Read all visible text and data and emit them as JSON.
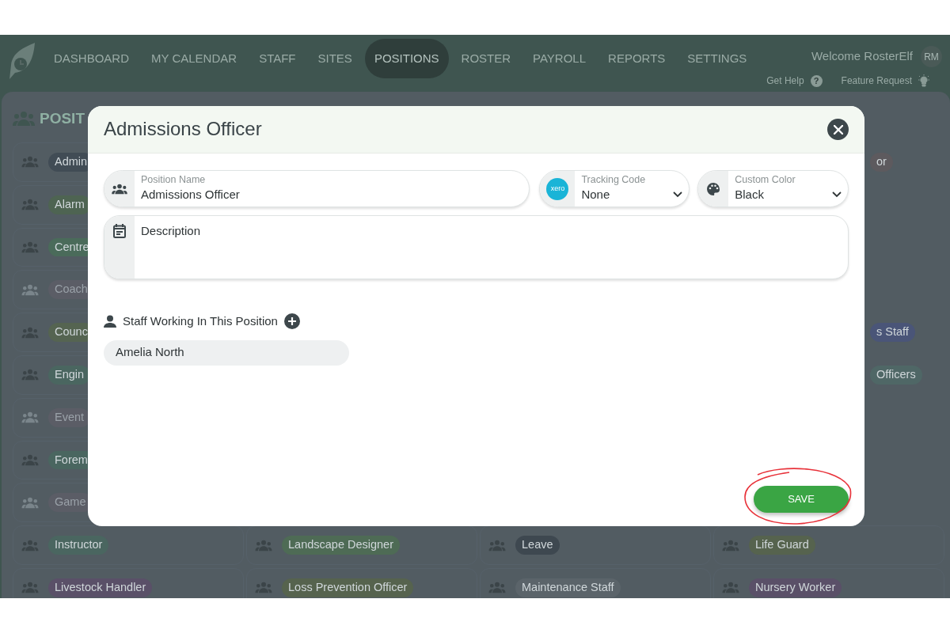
{
  "nav": {
    "items": [
      {
        "label": "DASHBOARD",
        "selected": false
      },
      {
        "label": "MY CALENDAR",
        "selected": false
      },
      {
        "label": "STAFF",
        "selected": false
      },
      {
        "label": "SITES",
        "selected": false
      },
      {
        "label": "POSITIONS",
        "selected": true
      },
      {
        "label": "ROSTER",
        "selected": false
      },
      {
        "label": "PAYROLL",
        "selected": false
      },
      {
        "label": "REPORTS",
        "selected": false
      },
      {
        "label": "SETTINGS",
        "selected": false
      }
    ],
    "welcome": "Welcome RosterElf",
    "avatar": "RM",
    "links": [
      {
        "label": "Get Help",
        "kind": "help",
        "glyph": "?"
      },
      {
        "label": "Feature Request",
        "kind": "idea"
      }
    ]
  },
  "page_title": "POSIT",
  "position_rows": [
    {
      "cells": [
        {
          "text": "Admin",
          "color": "#414c55",
          "faded": false
        },
        {
          "text": "or",
          "color": "#5d5a5e",
          "faded": false
        }
      ]
    },
    {
      "cells": [
        {
          "text": "Alarm",
          "color": "#4e6452",
          "faded": false
        }
      ]
    },
    {
      "cells": [
        {
          "text": "Centre",
          "color": "#4a6b5a",
          "faded": false
        }
      ]
    },
    {
      "cells": [
        {
          "text": "Coach",
          "color": "#5b5d66",
          "faded": true
        }
      ]
    },
    {
      "cells": [
        {
          "text": "Counc",
          "color": "#556451",
          "faded": false
        },
        {
          "text": "s Staff",
          "color": "#4a5578",
          "faded": false
        }
      ]
    },
    {
      "cells": [
        {
          "text": "Engin",
          "color": "#4a6660",
          "faded": false
        },
        {
          "text": "Officers",
          "color": "#4f6766",
          "faded": false
        }
      ]
    },
    {
      "cells": [
        {
          "text": "Event",
          "color": "#5b5d66",
          "faded": true
        }
      ]
    },
    {
      "cells": [
        {
          "text": "Forem",
          "color": "#4a6660",
          "faded": false
        }
      ]
    },
    {
      "cells": [
        {
          "text": "Game",
          "color": "#5b5d66",
          "faded": true
        }
      ]
    },
    {
      "cells": [
        {
          "text": "Instructor",
          "color": "#4a6660",
          "faded": false
        },
        {
          "text": "Landscape Designer",
          "color": "#4e6b55",
          "faded": false
        },
        {
          "text": "Leave",
          "color": "#3e4850",
          "faded": false
        },
        {
          "text": "Life Guard",
          "color": "#56634e",
          "faded": false
        }
      ]
    },
    {
      "cells": [
        {
          "text": "Livestock Handler",
          "color": "#5a5068",
          "faded": false
        },
        {
          "text": "Loss Prevention Officer",
          "color": "#56634e",
          "faded": false
        },
        {
          "text": "Maintenance Staff",
          "color": "#5b646a",
          "faded": false
        },
        {
          "text": "Nursery Worker",
          "color": "#5a5068",
          "faded": false
        }
      ]
    }
  ],
  "modal": {
    "title": "Admissions Officer",
    "position_name": {
      "label": "Position Name",
      "value": "Admissions Officer"
    },
    "tracking_code": {
      "label": "Tracking Code",
      "value": "None",
      "logo": "xero"
    },
    "custom_color": {
      "label": "Custom Color",
      "value": "Black"
    },
    "description": {
      "placeholder": "Description"
    },
    "staff_heading": "Staff Working In This Position",
    "staff": [
      "Amelia North"
    ],
    "save": "SAVE"
  }
}
